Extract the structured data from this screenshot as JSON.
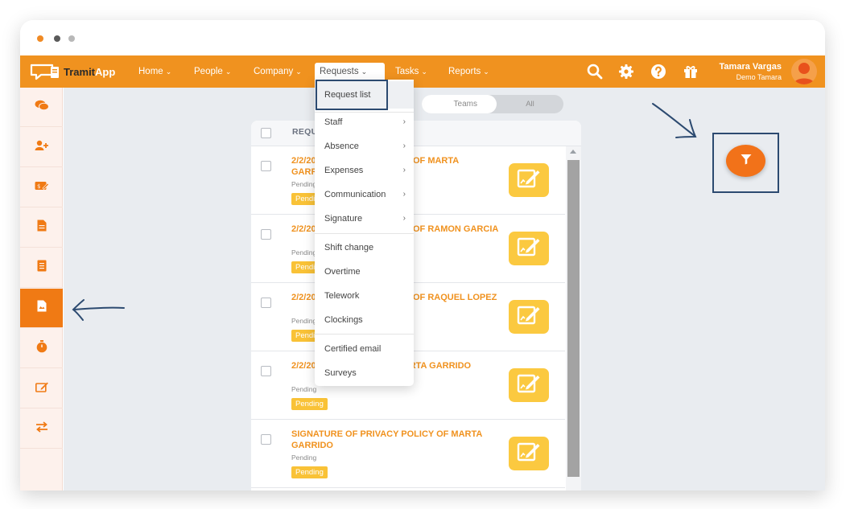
{
  "app": {
    "logo": {
      "part1": "Tramit",
      "part2": "App"
    }
  },
  "nav": {
    "items": [
      {
        "label": "Home",
        "chevron": "⌄"
      },
      {
        "label": "People",
        "chevron": "⌄"
      },
      {
        "label": "Company",
        "chevron": "⌄"
      },
      {
        "label": "Requests",
        "chevron": "⌄",
        "active": true
      },
      {
        "label": "Tasks",
        "chevron": "⌄"
      },
      {
        "label": "Reports",
        "chevron": "⌄"
      }
    ],
    "icons": [
      "search-icon",
      "gear-icon",
      "help-icon",
      "gift-icon"
    ],
    "user": {
      "name": "Tamara Vargas",
      "company": "Demo Tamara"
    }
  },
  "sidebar": {
    "items": [
      {
        "icon": "chat-icon"
      },
      {
        "icon": "add-user-icon"
      },
      {
        "icon": "expense-card-icon"
      },
      {
        "icon": "document-icon"
      },
      {
        "icon": "list-document-icon"
      },
      {
        "icon": "request-document-icon",
        "active": true
      },
      {
        "icon": "stopwatch-icon"
      },
      {
        "icon": "signature-icon"
      },
      {
        "icon": "transfer-icon"
      }
    ]
  },
  "filter_toggle": {
    "teams": "Teams",
    "all": "All"
  },
  "requests_panel": {
    "header": "REQUESTS",
    "rows": [
      {
        "title": "2/2/2023 MONTHLY REPORT OF MARTA GARRIDO",
        "status": "Pending",
        "badge": "Pending"
      },
      {
        "title": "2/2/2023 MONTHLY REPORT OF RAMON GARCIA",
        "status": "Pending",
        "badge": "Pending"
      },
      {
        "title": "2/2/2023 MONTHLY REPORT OF RAQUEL LOPEZ",
        "status": "Pending",
        "badge": "Pending"
      },
      {
        "title": "2/2/2023 VOUCHERS OF MARTA GARRIDO",
        "status": "Pending",
        "badge": "Pending"
      },
      {
        "title": "SIGNATURE OF PRIVACY POLICY OF MARTA GARRIDO",
        "status": "Pending",
        "badge": "Pending"
      }
    ]
  },
  "requests_menu": {
    "items": [
      {
        "label": "Request list"
      },
      {
        "label": "Staff",
        "submenu": "›"
      },
      {
        "label": "Absence",
        "submenu": "›"
      },
      {
        "label": "Expenses",
        "submenu": "›"
      },
      {
        "label": "Communication",
        "submenu": "›"
      },
      {
        "label": "Signature",
        "submenu": "›"
      },
      {
        "label": "Shift change"
      },
      {
        "label": "Overtime"
      },
      {
        "label": "Telework"
      },
      {
        "label": "Clockings"
      },
      {
        "label": "Certified email"
      },
      {
        "label": "Surveys"
      }
    ]
  },
  "colors": {
    "brand_orange": "#f0921f",
    "active_sidebar": "#f07a14",
    "badge_yellow": "#f9c237",
    "annotation_blue": "#2c4a70"
  }
}
